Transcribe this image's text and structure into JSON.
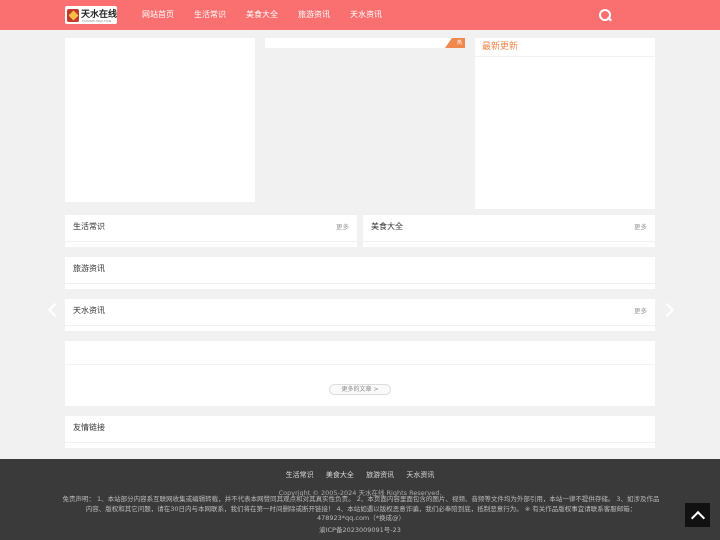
{
  "header": {
    "logo_text": "天水在线",
    "logo_subtext": "TIANSHUIZAIXIAN",
    "nav": [
      "网站首页",
      "生活常识",
      "美食大全",
      "旅游资讯",
      "天水资讯"
    ]
  },
  "featured": {
    "corner_tag": "热",
    "latest_title": "最新更新"
  },
  "sections": {
    "life": {
      "title": "生活常识",
      "more": "更多"
    },
    "food": {
      "title": "美食大全",
      "more": "更多"
    },
    "travel": {
      "title": "旅游资讯"
    },
    "news": {
      "title": "天水资讯",
      "more": "更多"
    }
  },
  "articles": {
    "more_button": "更多的文章 >"
  },
  "links": {
    "title": "友情链接"
  },
  "footer": {
    "nav": [
      "生活常识",
      "美食大全",
      "旅游资讯",
      "天水资讯"
    ],
    "copyright": "Copyright © 2005-2024   天水在线   Rights Reserved.",
    "disclaimer": "免责声明： 1、本站部分内容系互联网收集或编辑转载，并不代表本网赞同其观点和对其真实性负责。 2、本页面内容里面包含的图片、视频、音频等文件均为外部引用，本站一律不提供存储。 3、如涉及作品内容、版权和其它问题，请在30日内与本网联系，我们将在第一时间删除或断开链接！ 4、本站如遇以版权恶意诈骗，我们必奉陪到底，抵制恶意行为。 ※ 有关作品版权事宜请联系客服邮箱：478923*qq.com（*换成@）",
    "icp": "渝ICP备2023009091号-23"
  },
  "colors": {
    "header_bg": "#fa7070",
    "accent": "#f0874d",
    "footer_bg": "#3a3a3a"
  }
}
